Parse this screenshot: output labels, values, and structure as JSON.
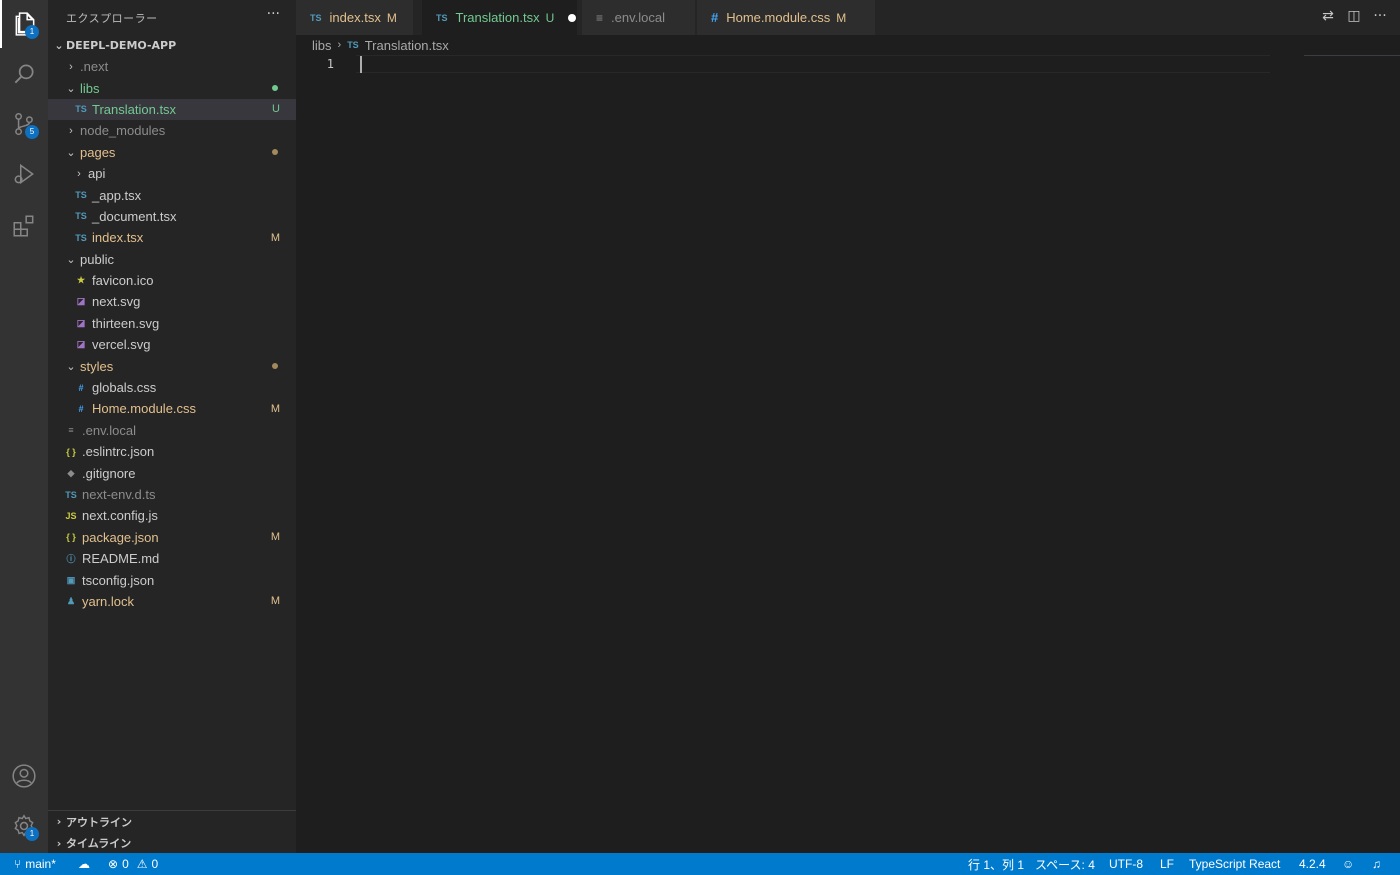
{
  "activity_bar": {
    "explorer_badge": "1",
    "scm_badge": "5",
    "settings_badge": "1"
  },
  "sidebar": {
    "title": "エクスプローラー",
    "more": "···",
    "root": "DEEPL-DEMO-APP",
    "items": [
      {
        "label": ".next",
        "chev": "›",
        "icon": "",
        "status": "",
        "dot": ""
      },
      {
        "label": "libs",
        "chev": "⌄",
        "icon": "",
        "status": "",
        "dot": "#73c991"
      },
      {
        "label": "Translation.tsx",
        "chev": "",
        "icon": "TS",
        "status": "U",
        "dot": ""
      },
      {
        "label": "node_modules",
        "chev": "›",
        "icon": "",
        "status": "",
        "dot": ""
      },
      {
        "label": "pages",
        "chev": "⌄",
        "icon": "",
        "status": "",
        "dot": "#a3895b"
      },
      {
        "label": "api",
        "chev": "›",
        "icon": "",
        "status": "",
        "dot": ""
      },
      {
        "label": "_app.tsx",
        "chev": "",
        "icon": "TS",
        "status": "",
        "dot": ""
      },
      {
        "label": "_document.tsx",
        "chev": "",
        "icon": "TS",
        "status": "",
        "dot": ""
      },
      {
        "label": "index.tsx",
        "chev": "",
        "icon": "TS",
        "status": "M",
        "dot": ""
      },
      {
        "label": "public",
        "chev": "⌄",
        "icon": "",
        "status": "",
        "dot": ""
      },
      {
        "label": "favicon.ico",
        "chev": "",
        "icon": "★",
        "status": "",
        "dot": ""
      },
      {
        "label": "next.svg",
        "chev": "",
        "icon": "◪",
        "status": "",
        "dot": ""
      },
      {
        "label": "thirteen.svg",
        "chev": "",
        "icon": "◪",
        "status": "",
        "dot": ""
      },
      {
        "label": "vercel.svg",
        "chev": "",
        "icon": "◪",
        "status": "",
        "dot": ""
      },
      {
        "label": "styles",
        "chev": "⌄",
        "icon": "",
        "status": "",
        "dot": "#a3895b"
      },
      {
        "label": "globals.css",
        "chev": "",
        "icon": "#",
        "status": "",
        "dot": ""
      },
      {
        "label": "Home.module.css",
        "chev": "",
        "icon": "#",
        "status": "M",
        "dot": ""
      },
      {
        "label": ".env.local",
        "chev": "",
        "icon": "≡",
        "status": "",
        "dot": ""
      },
      {
        "label": ".eslintrc.json",
        "chev": "",
        "icon": "{ }",
        "status": "",
        "dot": ""
      },
      {
        "label": ".gitignore",
        "chev": "",
        "icon": "◆",
        "status": "",
        "dot": ""
      },
      {
        "label": "next-env.d.ts",
        "chev": "",
        "icon": "TS",
        "status": "",
        "dot": ""
      },
      {
        "label": "next.config.js",
        "chev": "",
        "icon": "JS",
        "status": "",
        "dot": ""
      },
      {
        "label": "package.json",
        "chev": "",
        "icon": "{ }",
        "status": "M",
        "dot": ""
      },
      {
        "label": "README.md",
        "chev": "",
        "icon": "ⓘ",
        "status": "",
        "dot": ""
      },
      {
        "label": "tsconfig.json",
        "chev": "",
        "icon": "▣",
        "status": "",
        "dot": ""
      },
      {
        "label": "yarn.lock",
        "chev": "",
        "icon": "♟",
        "status": "M",
        "dot": ""
      }
    ],
    "outline": "アウトライン",
    "timeline": "タイムライン"
  },
  "tabs": [
    {
      "icon": "TS",
      "label": "index.tsx",
      "status": "M"
    },
    {
      "icon": "TS",
      "label": "Translation.tsx",
      "status": "U"
    },
    {
      "icon": "≡",
      "label": ".env.local",
      "status": ""
    },
    {
      "icon": "#",
      "label": "Home.module.css",
      "status": "M"
    }
  ],
  "breadcrumb": {
    "folder": "libs",
    "separator": "›",
    "file_icon": "TS",
    "file": "Translation.tsx"
  },
  "editor": {
    "line_number": "1"
  },
  "status_bar": {
    "branch": "main*",
    "errors": "0",
    "warnings": "0",
    "position": "行 1、列 1",
    "spaces": "スペース: 4",
    "encoding": "UTF-8",
    "eol": "LF",
    "language": "TypeScript React",
    "version": "4.2.4"
  },
  "colors": {
    "accent": "#007acc",
    "modified": "#e2c08d",
    "untracked": "#73c991"
  }
}
